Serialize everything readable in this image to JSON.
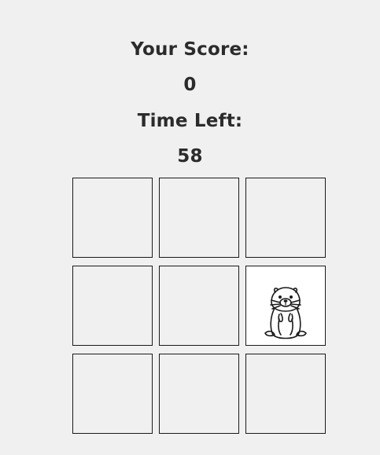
{
  "scoreboard": {
    "score_label": "Your Score:",
    "score_value": "0",
    "time_label": "Time Left:",
    "time_value": "58"
  },
  "board": {
    "rows": 3,
    "cols": 3,
    "mole_position": {
      "row": 2,
      "col": 3
    },
    "mole_icon": "groundhog-icon"
  }
}
